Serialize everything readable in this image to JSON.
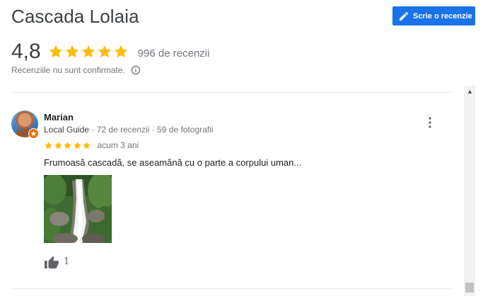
{
  "place": {
    "title": "Cascada Lolaia"
  },
  "actions": {
    "write_review_label": "Scrie o recenzie",
    "pencil_icon": "pencil-icon"
  },
  "summary": {
    "rating": "4,8",
    "stars_filled": 5,
    "review_count": "996 de recenzii",
    "unconfirmed_note": "Recenziile nu sunt confirmate.",
    "info_icon": "info-icon"
  },
  "colors": {
    "accent": "#1a73e8",
    "star": "#fbbc04",
    "guide_badge": "#e8710a"
  },
  "reviews": [
    {
      "author": "Marian",
      "guide_label": "Local Guide",
      "meta": " · 72 de recenzii · 59 de fotografii",
      "stars": 5,
      "time": "acum 3 ani",
      "text": "Frumoasă cascadă, se aseamănă cu o parte a corpului uman...",
      "likes": "1",
      "photo": "waterfall-photo"
    }
  ]
}
